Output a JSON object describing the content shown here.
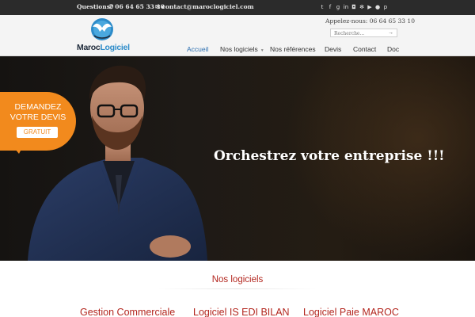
{
  "topbar": {
    "questions": "Questions?",
    "phone": "06 64 65 33 10",
    "email": "contact@maroclogiciel.com",
    "social_icons": [
      "twitter-icon",
      "facebook-icon",
      "google-plus-icon",
      "linkedin-icon",
      "instagram-icon",
      "yelp-icon",
      "youtube-icon",
      "flickr-icon",
      "pinterest-icon"
    ]
  },
  "header": {
    "logo_part1": "Maroc",
    "logo_part2": "Logiciel",
    "callus": "Appelez-nous: 06 64 65 33 10",
    "search_placeholder": "Recherche...",
    "nav": [
      {
        "label": "Accueil",
        "active": true
      },
      {
        "label": "Nos logiciels",
        "has_submenu": true
      },
      {
        "label": "Nos références"
      },
      {
        "label": "Devis"
      },
      {
        "label": "Contact"
      },
      {
        "label": "Doc"
      }
    ]
  },
  "hero": {
    "headline": "Orchestrez votre entreprise !!!",
    "devis_line1": "DEMANDEZ",
    "devis_line2": "VOTRE DEVIS",
    "devis_button": "GRATUIT"
  },
  "products": {
    "title": "Nos logiciels",
    "items": [
      "Gestion Commerciale",
      "Logiciel IS EDI BILAN",
      "Logiciel Paie MAROC"
    ]
  },
  "colors": {
    "accent_red": "#b3261e",
    "accent_orange": "#f28a1d",
    "nav_active": "#2c6fb0",
    "logo_blue": "#2c8bc9",
    "topbar_bg": "#2b2b2b"
  }
}
